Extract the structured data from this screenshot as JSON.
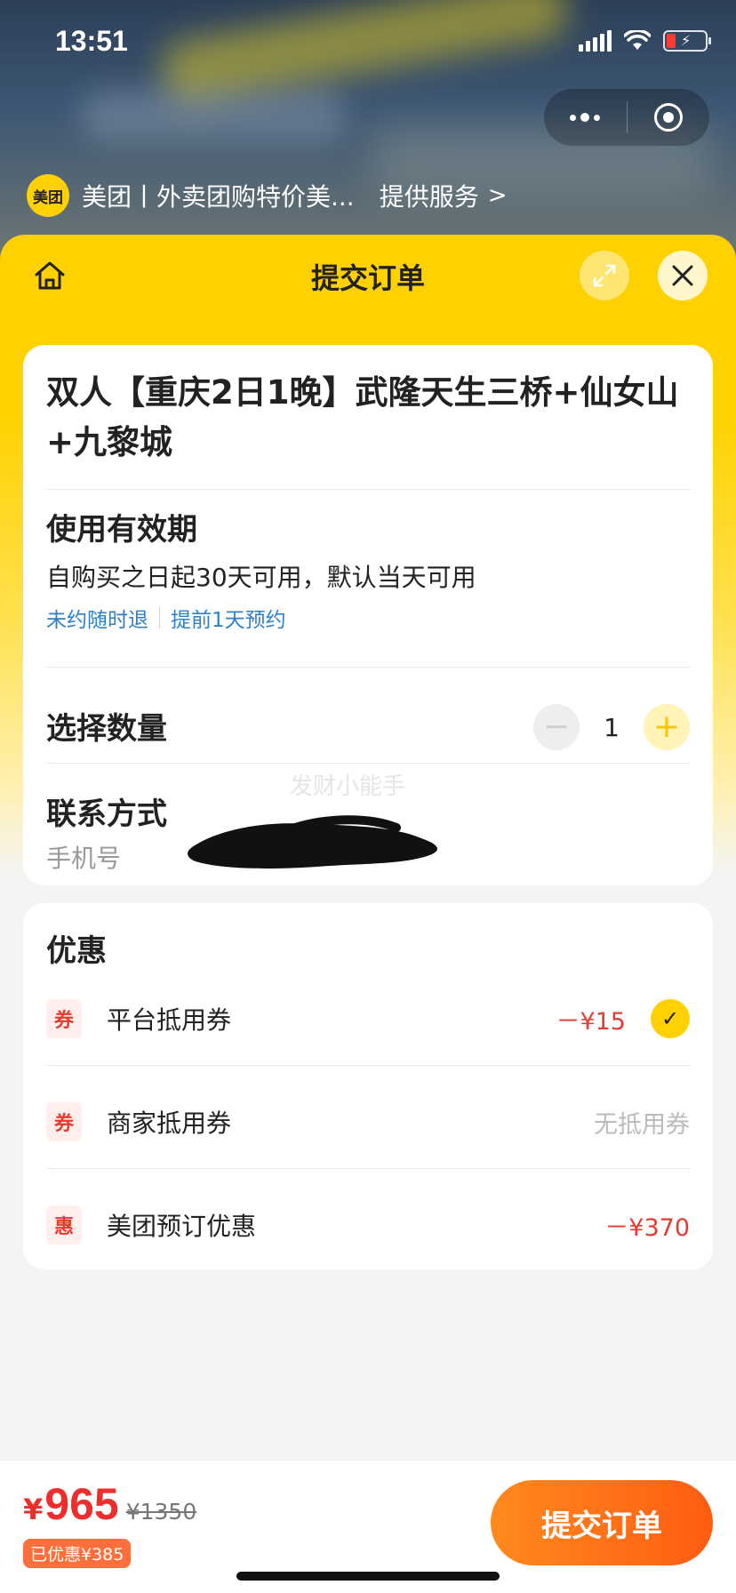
{
  "status_bar": {
    "time": "13:51"
  },
  "miniapp": {
    "logo_text": "美团",
    "name": "美团丨外卖团购特价美...",
    "service_label": "提供服务",
    "chevron": ">"
  },
  "sheet": {
    "title": "提交订单",
    "home_icon": "home-icon",
    "expand_icon": "expand-icon",
    "close_icon": "close-icon"
  },
  "product": {
    "title": "双人【重庆2日1晚】武隆天生三桥+仙女山+九黎城"
  },
  "validity": {
    "title": "使用有效期",
    "desc": "自购买之日起30天可用，默认当天可用",
    "tags": [
      "未约随时退",
      "提前1天预约"
    ]
  },
  "quantity": {
    "label": "选择数量",
    "minus": "−",
    "value": "1",
    "plus": "+"
  },
  "watermark": "发财小能手",
  "contact": {
    "title": "联系方式",
    "phone_label": "手机号"
  },
  "discounts": {
    "title": "优惠",
    "rows": [
      {
        "badge": "券",
        "name": "平台抵用券",
        "value": "－¥15",
        "checked": true
      },
      {
        "badge": "券",
        "name": "商家抵用券",
        "value": "无抵用券",
        "checked": false
      },
      {
        "badge": "惠",
        "name": "美团预订优惠",
        "value": "－¥370",
        "checked": false
      }
    ]
  },
  "bottom": {
    "currency": "¥",
    "price": "965",
    "original_price": "¥1350",
    "saved": "已优惠¥385",
    "submit_label": "提交订单"
  },
  "colors": {
    "brand_yellow": "#ffd100",
    "price_red": "#ee2d2d",
    "submit_orange": "#ff6a15",
    "link_blue": "#2f80c9"
  }
}
